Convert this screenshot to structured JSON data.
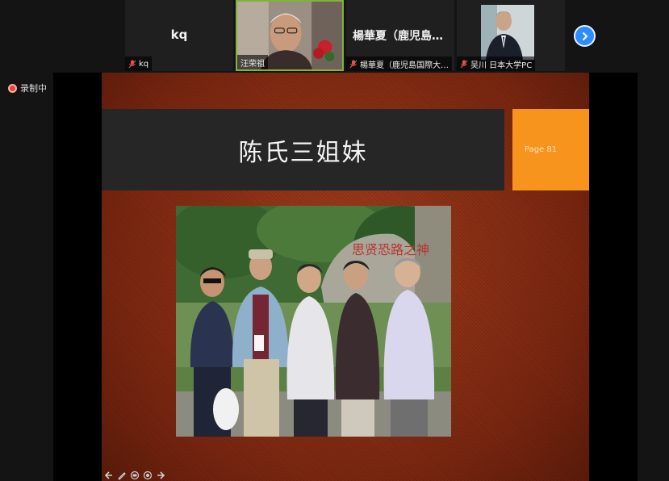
{
  "participants": [
    {
      "id": "kq",
      "big_name": "kq",
      "name": "kq",
      "muted": true,
      "video": false
    },
    {
      "id": "host",
      "big_name": "",
      "name": "汪荣祖",
      "muted": false,
      "video": true,
      "active": true
    },
    {
      "id": "yang",
      "big_name": "楊華夏（鹿児島…",
      "name": "楊華夏（鹿児島国際大…",
      "muted": true,
      "video": false
    },
    {
      "id": "wuchuan",
      "big_name": "",
      "name": "吴川 日本大学PC",
      "muted": true,
      "video": true
    }
  ],
  "next_icon": "chevron-right-icon",
  "recording": {
    "label": "录制中",
    "color": "#e8452c"
  },
  "slide": {
    "title": "陈氏三姐妹",
    "page_label": "Page 81",
    "colors": {
      "background": "#8a2f14",
      "title_box": "#262626",
      "page_box": "#f7941d"
    },
    "photo_inscription": "思贤恐路之神",
    "controls": [
      "arrow-left-icon",
      "pen-icon",
      "slides-icon",
      "zoom-icon",
      "arrow-right-icon"
    ]
  },
  "accent_color": "#2d8cff"
}
